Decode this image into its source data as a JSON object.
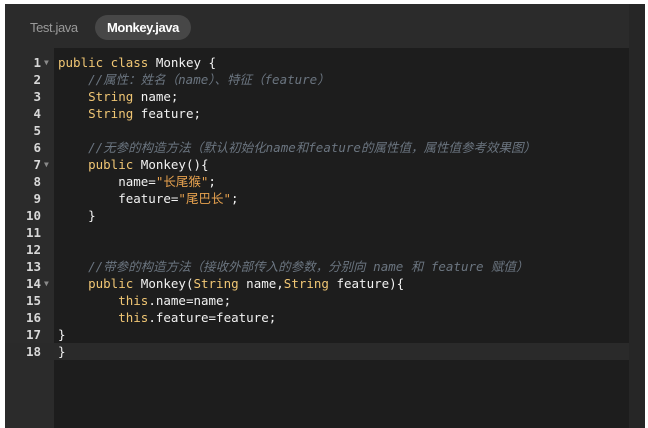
{
  "tabs": [
    {
      "label": "Test.java",
      "active": false
    },
    {
      "label": "Monkey.java",
      "active": true
    }
  ],
  "lines": [
    {
      "n": "1",
      "fold": true,
      "segs": [
        [
          "kw",
          "public class "
        ],
        [
          "plain",
          "Monkey {"
        ]
      ]
    },
    {
      "n": "2",
      "fold": false,
      "segs": [
        [
          "plain",
          "    "
        ],
        [
          "cmt",
          "//属性：姓名（name）、特征（feature）"
        ]
      ]
    },
    {
      "n": "3",
      "fold": false,
      "segs": [
        [
          "plain",
          "    "
        ],
        [
          "type",
          "String"
        ],
        [
          "plain",
          " name;"
        ]
      ]
    },
    {
      "n": "4",
      "fold": false,
      "segs": [
        [
          "plain",
          "    "
        ],
        [
          "type",
          "String"
        ],
        [
          "plain",
          " feature;"
        ]
      ]
    },
    {
      "n": "5",
      "fold": false,
      "segs": []
    },
    {
      "n": "6",
      "fold": false,
      "segs": [
        [
          "plain",
          "    "
        ],
        [
          "cmt",
          "//无参的构造方法（默认初始化name和feature的属性值，属性值参考效果图）"
        ]
      ]
    },
    {
      "n": "7",
      "fold": true,
      "segs": [
        [
          "plain",
          "    "
        ],
        [
          "kw",
          "public "
        ],
        [
          "plain",
          "Monkey(){"
        ]
      ]
    },
    {
      "n": "8",
      "fold": false,
      "segs": [
        [
          "plain",
          "        name="
        ],
        [
          "str",
          "\"长尾猴\""
        ],
        [
          "plain",
          ";"
        ]
      ]
    },
    {
      "n": "9",
      "fold": false,
      "segs": [
        [
          "plain",
          "        feature="
        ],
        [
          "str",
          "\"尾巴长\""
        ],
        [
          "plain",
          ";"
        ]
      ]
    },
    {
      "n": "10",
      "fold": false,
      "segs": [
        [
          "plain",
          "    }"
        ]
      ]
    },
    {
      "n": "11",
      "fold": false,
      "segs": []
    },
    {
      "n": "12",
      "fold": false,
      "segs": []
    },
    {
      "n": "13",
      "fold": false,
      "segs": [
        [
          "plain",
          "    "
        ],
        [
          "cmt",
          "//带参的构造方法（接收外部传入的参数，分别向 name 和 feature 赋值）"
        ]
      ]
    },
    {
      "n": "14",
      "fold": true,
      "segs": [
        [
          "plain",
          "    "
        ],
        [
          "kw",
          "public "
        ],
        [
          "plain",
          "Monkey("
        ],
        [
          "type",
          "String"
        ],
        [
          "plain",
          " name,"
        ],
        [
          "type",
          "String"
        ],
        [
          "plain",
          " feature){"
        ]
      ]
    },
    {
      "n": "15",
      "fold": false,
      "segs": [
        [
          "plain",
          "        "
        ],
        [
          "this",
          "this"
        ],
        [
          "plain",
          ".name=name;"
        ]
      ]
    },
    {
      "n": "16",
      "fold": false,
      "segs": [
        [
          "plain",
          "        "
        ],
        [
          "this",
          "this"
        ],
        [
          "plain",
          ".feature=feature;"
        ]
      ]
    },
    {
      "n": "17",
      "fold": false,
      "segs": [
        [
          "plain",
          "}"
        ]
      ]
    },
    {
      "n": "18",
      "fold": false,
      "segs": [
        [
          "plain",
          "}"
        ]
      ],
      "active": true
    }
  ],
  "colors": {
    "keyword": "#f0c674",
    "string": "#e6a14e",
    "comment": "#6b7580",
    "text": "#f2f2f2",
    "background": "#1d1d1d",
    "gutter": "#2b2b2b"
  },
  "icons": {
    "fold": "triangle-down-icon"
  }
}
